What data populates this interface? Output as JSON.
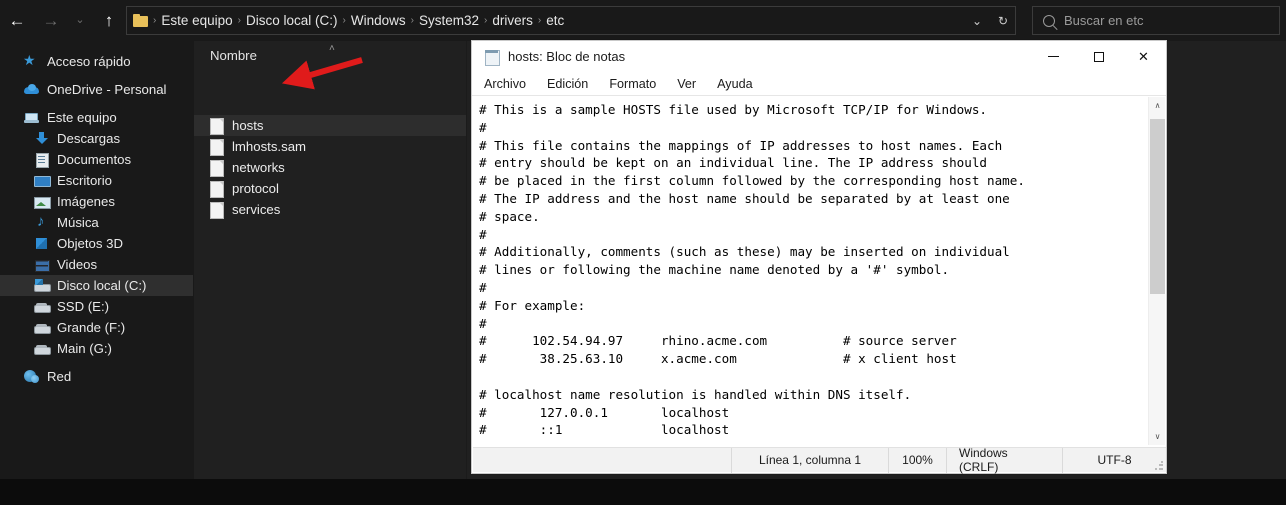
{
  "explorer": {
    "nav": {
      "back": "←",
      "forward": "→",
      "recent": "⌄",
      "up": "↑"
    },
    "breadcrumb": {
      "folder_icon": "folder-icon",
      "items": [
        "Este equipo",
        "Disco local (C:)",
        "Windows",
        "System32",
        "drivers",
        "etc"
      ],
      "separator": "›"
    },
    "address_controls": {
      "history_chevron": "⌄",
      "refresh": "↻"
    },
    "search": {
      "icon": "search-icon",
      "placeholder": "Buscar en etc"
    },
    "sidebar": {
      "items": [
        {
          "label": "Acceso rápido",
          "icon": "star-icon",
          "level": 1,
          "selected": false
        },
        {
          "label": "OneDrive - Personal",
          "icon": "cloud-icon",
          "level": 1,
          "selected": false
        },
        {
          "label": "Este equipo",
          "icon": "computer-icon",
          "level": 1,
          "selected": false
        },
        {
          "label": "Descargas",
          "icon": "download-icon",
          "level": 2,
          "selected": false
        },
        {
          "label": "Documentos",
          "icon": "documents-icon",
          "level": 2,
          "selected": false
        },
        {
          "label": "Escritorio",
          "icon": "desktop-icon",
          "level": 2,
          "selected": false
        },
        {
          "label": "Imágenes",
          "icon": "pictures-icon",
          "level": 2,
          "selected": false
        },
        {
          "label": "Música",
          "icon": "music-icon",
          "level": 2,
          "selected": false
        },
        {
          "label": "Objetos 3D",
          "icon": "objects3d-icon",
          "level": 2,
          "selected": false
        },
        {
          "label": "Videos",
          "icon": "videos-icon",
          "level": 2,
          "selected": false
        },
        {
          "label": "Disco local (C:)",
          "icon": "hard-drive-system-icon",
          "level": 2,
          "selected": true
        },
        {
          "label": "SSD (E:)",
          "icon": "hard-drive-icon",
          "level": 2,
          "selected": false
        },
        {
          "label": "Grande (F:)",
          "icon": "hard-drive-icon",
          "level": 2,
          "selected": false
        },
        {
          "label": "Main (G:)",
          "icon": "hard-drive-icon",
          "level": 2,
          "selected": false
        },
        {
          "label": "Red",
          "icon": "network-icon",
          "level": 1,
          "selected": false
        }
      ]
    },
    "file_list": {
      "column_header": "Nombre",
      "sort_indicator": "˄",
      "rows": [
        {
          "name": "hosts",
          "selected": true
        },
        {
          "name": "lmhosts.sam",
          "selected": false
        },
        {
          "name": "networks",
          "selected": false
        },
        {
          "name": "protocol",
          "selected": false
        },
        {
          "name": "services",
          "selected": false
        }
      ]
    },
    "annotation": {
      "type": "red-arrow",
      "color": "#e01b1b",
      "points_to": "hosts"
    }
  },
  "notepad": {
    "title": "hosts: Bloc de notas",
    "icon": "notepad-icon",
    "window_buttons": {
      "minimize": "minimize-icon",
      "maximize": "maximize-icon",
      "close": "✕"
    },
    "menu": [
      "Archivo",
      "Edición",
      "Formato",
      "Ver",
      "Ayuda"
    ],
    "content_lines": [
      "# This is a sample HOSTS file used by Microsoft TCP/IP for Windows.",
      "#",
      "# This file contains the mappings of IP addresses to host names. Each",
      "# entry should be kept on an individual line. The IP address should",
      "# be placed in the first column followed by the corresponding host name.",
      "# The IP address and the host name should be separated by at least one",
      "# space.",
      "#",
      "# Additionally, comments (such as these) may be inserted on individual",
      "# lines or following the machine name denoted by a '#' symbol.",
      "#",
      "# For example:",
      "#",
      "#      102.54.94.97     rhino.acme.com          # source server",
      "#       38.25.63.10     x.acme.com              # x client host",
      "",
      "# localhost name resolution is handled within DNS itself.",
      "#\t127.0.0.1       localhost",
      "#\t::1             localhost"
    ],
    "scrollbar": {
      "up_arrow": "∧",
      "down_arrow": "∨"
    },
    "status_bar": {
      "position": "Línea 1, columna 1",
      "zoom": "100%",
      "line_ending": "Windows (CRLF)",
      "encoding": "UTF-8"
    }
  }
}
